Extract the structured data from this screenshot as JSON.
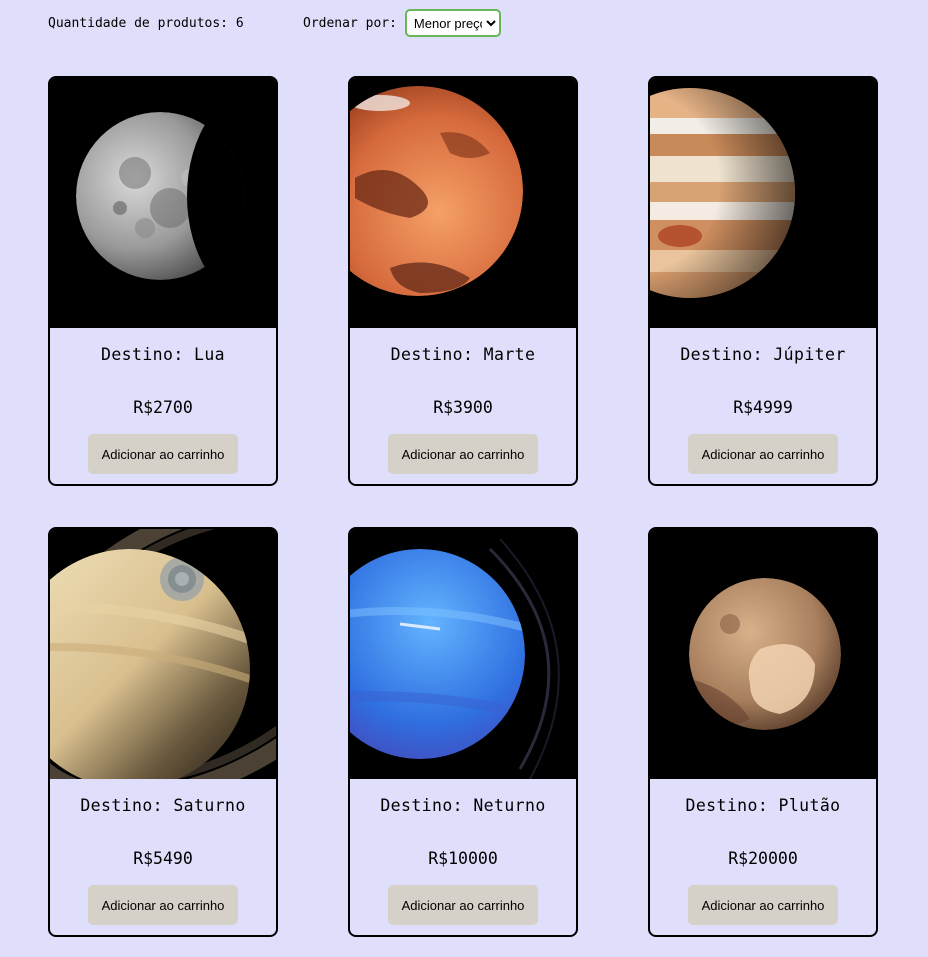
{
  "toolbar": {
    "count_text": "Quantidade de produtos: 6",
    "order_label": "Ordenar por:",
    "sort_selected": "Menor preço"
  },
  "products": [
    {
      "title": "Destino: Lua",
      "price": "R$2700",
      "button": "Adicionar ao carrinho",
      "icon": "moon-icon"
    },
    {
      "title": "Destino: Marte",
      "price": "R$3900",
      "button": "Adicionar ao carrinho",
      "icon": "mars-icon"
    },
    {
      "title": "Destino: Júpiter",
      "price": "R$4999",
      "button": "Adicionar ao carrinho",
      "icon": "jupiter-icon"
    },
    {
      "title": "Destino: Saturno",
      "price": "R$5490",
      "button": "Adicionar ao carrinho",
      "icon": "saturn-icon"
    },
    {
      "title": "Destino: Neturno",
      "price": "R$10000",
      "button": "Adicionar ao carrinho",
      "icon": "neptune-icon"
    },
    {
      "title": "Destino: Plutão",
      "price": "R$20000",
      "button": "Adicionar ao carrinho",
      "icon": "pluto-icon"
    }
  ],
  "colors": {
    "page_background": "#e0dffb",
    "button_background": "#d6d1c8",
    "select_border": "#67b65a"
  }
}
